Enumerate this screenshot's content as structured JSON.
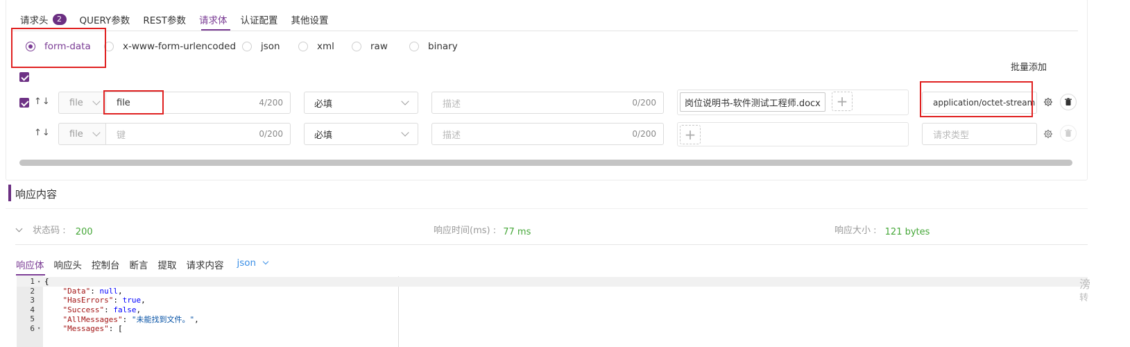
{
  "tabs": [
    {
      "label": "请求头",
      "badge": "2"
    },
    {
      "label": "QUERY参数"
    },
    {
      "label": "REST参数"
    },
    {
      "label": "请求体"
    },
    {
      "label": "认证配置"
    },
    {
      "label": "其他设置"
    }
  ],
  "active_tab": "请求体",
  "body_types": [
    "form-data",
    "x-www-form-urlencoded",
    "json",
    "xml",
    "raw",
    "binary"
  ],
  "selected_body_type": "form-data",
  "batch_add_label": "批量添加",
  "rows": [
    {
      "checked": true,
      "arrows": "↑↓",
      "type": "file",
      "key": "file",
      "key_count": "4/200",
      "required": "必填",
      "desc_placeholder": "描述",
      "desc_count": "0/200",
      "file_name": "岗位说明书-软件测试工程师.docx",
      "content_type": "application/octet-stream"
    },
    {
      "checked": false,
      "arrows": "↑↓",
      "type": "file",
      "key_placeholder": "键",
      "key_count": "0/200",
      "required": "必填",
      "desc_placeholder": "描述",
      "desc_count": "0/200",
      "content_type_placeholder": "请求类型"
    }
  ],
  "response": {
    "section_title": "响应内容",
    "status_label": "状态码 :",
    "status_value": "200",
    "time_label": "响应时间(ms) :",
    "time_value": "77 ms",
    "size_label": "响应大小 :",
    "size_value": "121 bytes",
    "tabs": [
      "响应体",
      "响应头",
      "控制台",
      "断言",
      "提取",
      "请求内容"
    ],
    "format": "json",
    "code_lines": [
      {
        "n": "1",
        "fold": true,
        "text": "{"
      },
      {
        "n": "2",
        "key": "\"Data\"",
        "val": "null",
        "val_type": "b",
        "tail": ","
      },
      {
        "n": "3",
        "key": "\"HasErrors\"",
        "val": "true",
        "val_type": "b",
        "tail": ","
      },
      {
        "n": "4",
        "key": "\"Success\"",
        "val": "false",
        "val_type": "b",
        "tail": ","
      },
      {
        "n": "5",
        "key": "\"AllMessages\"",
        "val": "\"未能找到文件。\"",
        "val_type": "s",
        "tail": ","
      },
      {
        "n": "6",
        "fold": true,
        "key": "\"Messages\"",
        "val": "[",
        "val_type": "p",
        "tail": ""
      }
    ]
  },
  "edge": {
    "char1": "滂",
    "char2": "转"
  },
  "colors": {
    "accent": "#7a3b94",
    "highlight": "#e02020",
    "success": "#45a738",
    "link": "#3a8ee6"
  }
}
